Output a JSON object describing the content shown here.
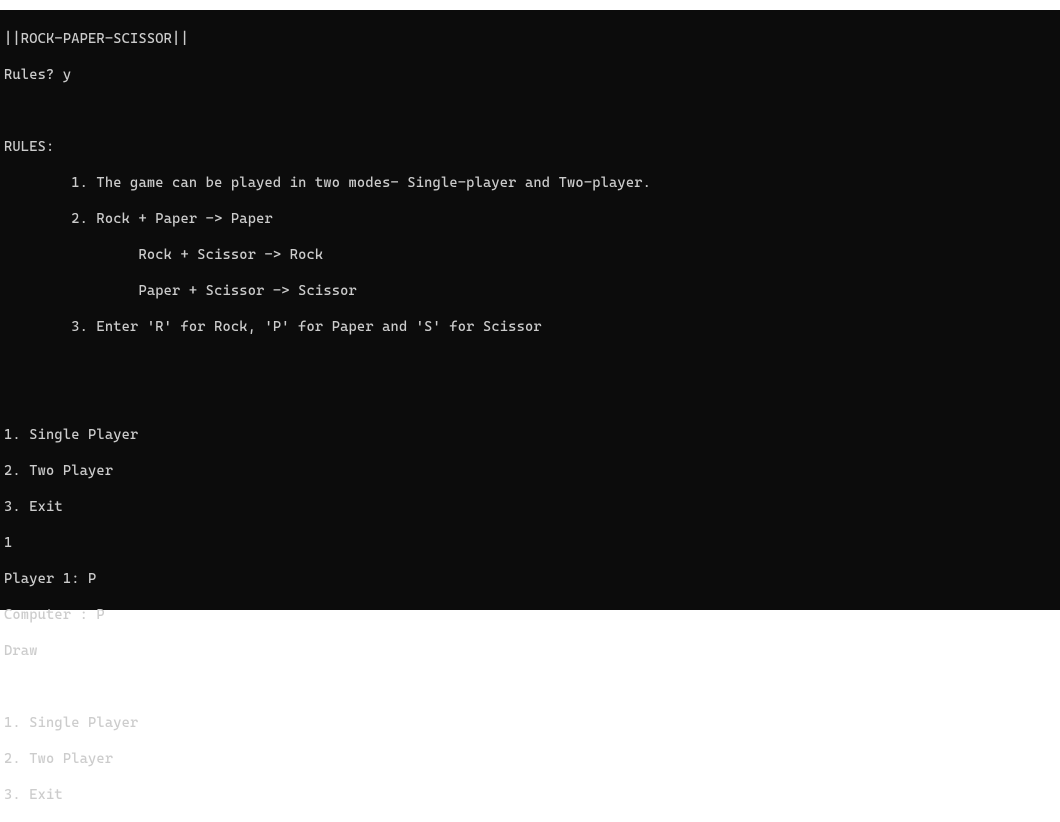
{
  "colors": {
    "background": "#0c0c0c",
    "foreground": "#cccccc"
  },
  "lines": {
    "header": "||ROCK-PAPER-SCISSOR||",
    "rules_prompt": "Rules? y",
    "blank1": "",
    "rules_heading": "RULES:",
    "rule1": "        1. The game can be played in two modes- Single-player and Two-player.",
    "rule2": "        2. Rock + Paper -> Paper",
    "rule2a": "                Rock + Scissor -> Rock",
    "rule2b": "                Paper + Scissor -> Scissor",
    "rule3": "        3. Enter 'R' for Rock, 'P' for Paper and 'S' for Scissor",
    "blank2": "",
    "blank3": "",
    "menu1_opt1": "1. Single Player",
    "menu1_opt2": "2. Two Player",
    "menu1_opt3": "3. Exit",
    "input_choice": "1",
    "player1": "Player 1: P",
    "computer": "Computer : P",
    "result": "Draw",
    "blank4": "",
    "menu2_opt1": "1. Single Player",
    "menu2_opt2": "2. Two Player",
    "menu2_opt3": "3. Exit"
  }
}
